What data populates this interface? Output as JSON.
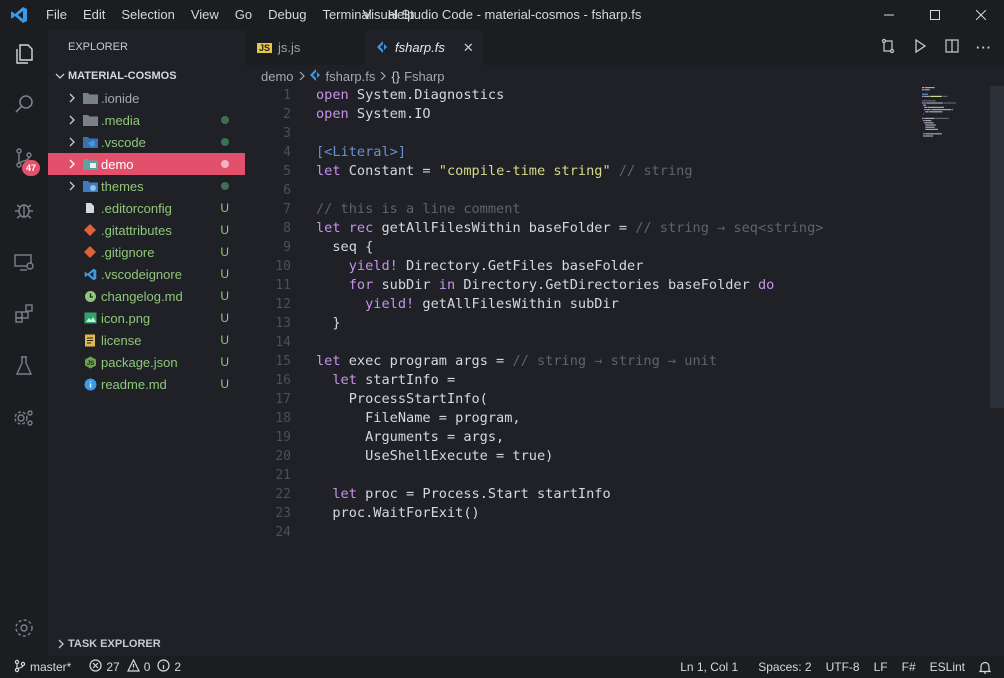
{
  "window": {
    "title": "Visual Studio Code - material-cosmos - fsharp.fs"
  },
  "menu": [
    "File",
    "Edit",
    "Selection",
    "View",
    "Go",
    "Debug",
    "Terminal",
    "Help"
  ],
  "activity": {
    "scm_badge": "47"
  },
  "sidebar": {
    "title": "EXPLORER",
    "folder": "MATERIAL-COSMOS",
    "items": [
      {
        "label": ".ionide",
        "kind": "folder",
        "status": "",
        "color": "#a4a9b1",
        "icon": "folder-icon"
      },
      {
        "label": ".media",
        "kind": "folder",
        "status": "dot",
        "color": "#8fc77a",
        "icon": "folder-icon"
      },
      {
        "label": ".vscode",
        "kind": "folder",
        "status": "dot",
        "color": "#8fc77a",
        "icon": "vscode-folder-icon"
      },
      {
        "label": "demo",
        "kind": "folder",
        "status": "dot",
        "color": "#ffffff",
        "icon": "demo-folder-icon",
        "selected": true
      },
      {
        "label": "themes",
        "kind": "folder",
        "status": "dot",
        "color": "#8fc77a",
        "icon": "themes-folder-icon"
      },
      {
        "label": ".editorconfig",
        "kind": "file",
        "status": "U",
        "color": "#8fc77a",
        "icon": "editorconfig-icon"
      },
      {
        "label": ".gitattributes",
        "kind": "file",
        "status": "U",
        "color": "#8fc77a",
        "icon": "git-icon"
      },
      {
        "label": ".gitignore",
        "kind": "file",
        "status": "U",
        "color": "#8fc77a",
        "icon": "git-icon"
      },
      {
        "label": ".vscodeignore",
        "kind": "file",
        "status": "U",
        "color": "#8fc77a",
        "icon": "vscode-icon"
      },
      {
        "label": "changelog.md",
        "kind": "file",
        "status": "U",
        "color": "#8fc77a",
        "icon": "changelog-icon"
      },
      {
        "label": "icon.png",
        "kind": "file",
        "status": "U",
        "color": "#8fc77a",
        "icon": "image-icon"
      },
      {
        "label": "license",
        "kind": "file",
        "status": "U",
        "color": "#8fc77a",
        "icon": "license-icon"
      },
      {
        "label": "package.json",
        "kind": "file",
        "status": "U",
        "color": "#8fc77a",
        "icon": "nodejs-icon"
      },
      {
        "label": "readme.md",
        "kind": "file",
        "status": "U",
        "color": "#8fc77a",
        "icon": "info-icon"
      }
    ],
    "bottom_section": "TASK EXPLORER"
  },
  "tabs": [
    {
      "label": "js.js",
      "icon_text": "JS",
      "active": false
    },
    {
      "label": "fsharp.fs",
      "active": true
    }
  ],
  "breadcrumb": {
    "folder": "demo",
    "file": "fsharp.fs",
    "symbol": "Fsharp"
  },
  "code": [
    [
      [
        "kw",
        "open"
      ],
      [
        "pl",
        " System.Diagnostics"
      ]
    ],
    [
      [
        "kw",
        "open"
      ],
      [
        "pl",
        " System.IO"
      ]
    ],
    [],
    [
      [
        "attr",
        "[<Literal>]"
      ]
    ],
    [
      [
        "kw",
        "let"
      ],
      [
        "pl",
        " Constant = "
      ],
      [
        "str",
        "\"compile-time string\""
      ],
      [
        "pl",
        " "
      ],
      [
        "cmt",
        "// string"
      ]
    ],
    [],
    [
      [
        "cmt",
        "// this is a line comment"
      ]
    ],
    [
      [
        "kw",
        "let"
      ],
      [
        "pl",
        " "
      ],
      [
        "kw",
        "rec"
      ],
      [
        "pl",
        " getAllFilesWithin baseFolder = "
      ],
      [
        "cmt",
        "// string → seq<string>"
      ]
    ],
    [
      [
        "pl",
        "  seq {"
      ]
    ],
    [
      [
        "pl",
        "    "
      ],
      [
        "kw",
        "yield!"
      ],
      [
        "pl",
        " Directory.GetFiles baseFolder"
      ]
    ],
    [
      [
        "pl",
        "    "
      ],
      [
        "kw",
        "for"
      ],
      [
        "pl",
        " subDir "
      ],
      [
        "kw",
        "in"
      ],
      [
        "pl",
        " Directory.GetDirectories baseFolder "
      ],
      [
        "kw",
        "do"
      ]
    ],
    [
      [
        "pl",
        "      "
      ],
      [
        "kw",
        "yield!"
      ],
      [
        "pl",
        " getAllFilesWithin subDir"
      ]
    ],
    [
      [
        "pl",
        "  }"
      ]
    ],
    [],
    [
      [
        "kw",
        "let"
      ],
      [
        "pl",
        " exec program args = "
      ],
      [
        "cmt",
        "// string → string → unit"
      ]
    ],
    [
      [
        "pl",
        "  "
      ],
      [
        "kw",
        "let"
      ],
      [
        "pl",
        " startInfo ="
      ]
    ],
    [
      [
        "pl",
        "    ProcessStartInfo("
      ]
    ],
    [
      [
        "pl",
        "      FileName = program,"
      ]
    ],
    [
      [
        "pl",
        "      Arguments = args,"
      ]
    ],
    [
      [
        "pl",
        "      UseShellExecute = true)"
      ]
    ],
    [],
    [
      [
        "pl",
        "  "
      ],
      [
        "kw",
        "let"
      ],
      [
        "pl",
        " proc = Process.Start startInfo"
      ]
    ],
    [
      [
        "pl",
        "  proc.WaitForExit()"
      ]
    ],
    []
  ],
  "statusbar": {
    "branch": "master*",
    "errors": "27",
    "warnings": "0",
    "infos": "2",
    "position": "Ln 1, Col 1",
    "spaces": "Spaces: 2",
    "encoding": "UTF-8",
    "eol": "LF",
    "language": "F#",
    "linter": "ESLint"
  },
  "colors": {
    "accent": "#e2506c",
    "background": "#1f2126",
    "keyword": "#c792ea",
    "string": "#d7d98b",
    "comment": "#5c6470"
  }
}
